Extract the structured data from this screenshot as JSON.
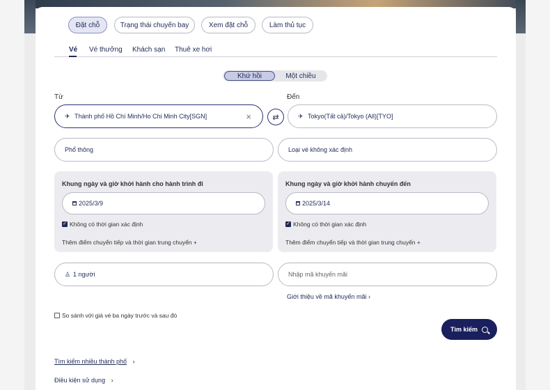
{
  "top_nav": {
    "items": [
      "Đặt chỗ",
      "Trạng thái chuyến bay",
      "Xem đặt chỗ",
      "Làm thủ tục"
    ]
  },
  "sub_tabs": [
    "Vé",
    "Vé thưởng",
    "Khách sạn",
    "Thuê xe hơi"
  ],
  "trip_type": {
    "round_trip": "Khứ hồi",
    "one_way": "Một chiều"
  },
  "from": {
    "label": "Từ",
    "value": "Thành phố Hồ Chí Minh/Ho Chi Minh City[SGN]",
    "clear_icon": "×"
  },
  "to": {
    "label": "Đến",
    "value": "Tokyo(Tất cả)/Tokyo (All)[TYO]"
  },
  "swap_icon": "⇄",
  "cabin": {
    "value": "Phổ thông"
  },
  "ticket_type": {
    "value": "Loại vé không xác định"
  },
  "outbound": {
    "title": "Khung ngày và giờ khởi hành cho hành trình đi",
    "date": "2025/3/9",
    "no_time_label": "Không có thời gian xác định",
    "add_stop": "Thêm điểm chuyển tiếp và thời gian trung chuyển  +"
  },
  "inbound": {
    "title": "Khung ngày và giờ khởi hành chuyến đến",
    "date": "2025/3/14",
    "no_time_label": "Không có thời gian xác định",
    "add_stop": "Thêm điểm chuyển tiếp và thời gian trung chuyển  +"
  },
  "passengers": {
    "value": "1 người"
  },
  "promo": {
    "placeholder": "Nhập mã khuyến mãi",
    "link": "Giới thiệu về mã khuyến mãi  ›"
  },
  "compare_label": "So sánh với giá vé ba ngày trước và sau đó",
  "search_button": "Tìm kiếm",
  "footer": {
    "multi_city": "Tìm kiếm nhiều thành phố",
    "multi_city_chev": "›",
    "terms": "Điều kiện sử dụng",
    "terms_chev": "›"
  },
  "colors": {
    "brand": "#1a1f5e",
    "panel": "#ececf0"
  }
}
